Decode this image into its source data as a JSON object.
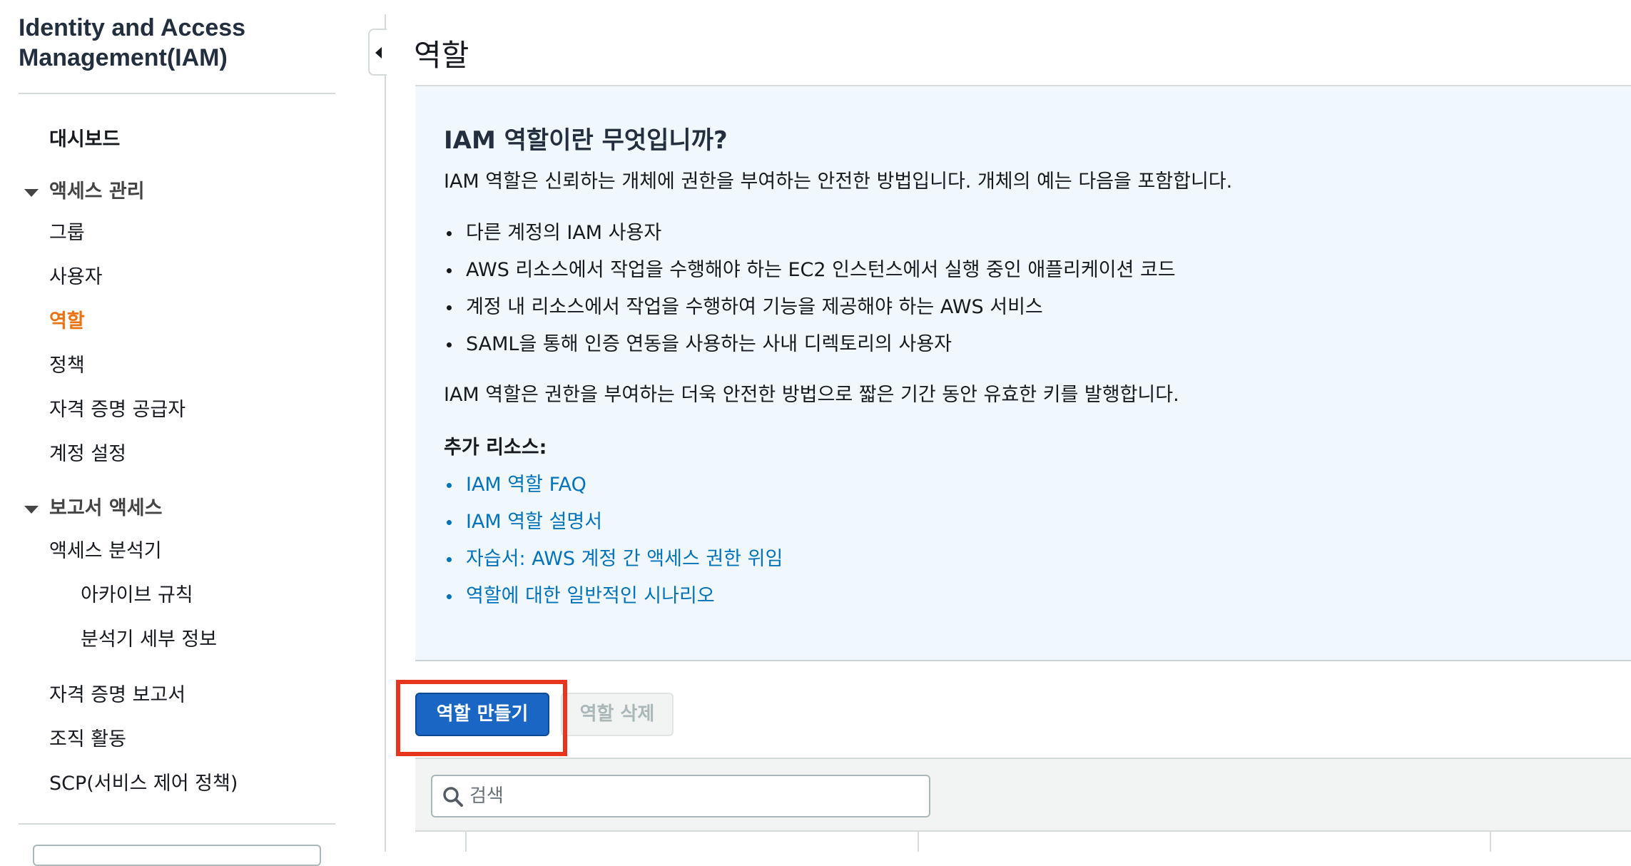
{
  "sidebar": {
    "title": "Identity and Access Management(IAM)",
    "dashboard": "대시보드",
    "access_management": {
      "label": "액세스 관리",
      "items": [
        "그룹",
        "사용자",
        "역할",
        "정책",
        "자격 증명 공급자",
        "계정 설정"
      ],
      "active_index": 2
    },
    "access_reports": {
      "label": "보고서 액세스",
      "analyzer": "액세스 분석기",
      "analyzer_items": [
        "아카이브 규칙",
        "분석기 세부 정보"
      ],
      "items": [
        "자격 증명 보고서",
        "조직 활동",
        "SCP(서비스 제어 정책)"
      ]
    }
  },
  "main": {
    "title": "역할",
    "info": {
      "heading": "IAM 역할이란 무엇입니까?",
      "intro": "IAM 역할은 신뢰하는 개체에 권한을 부여하는 안전한 방법입니다. 개체의 예는 다음을 포함합니다.",
      "examples": [
        "다른 계정의 IAM 사용자",
        "AWS 리소스에서 작업을 수행해야 하는 EC2 인스턴스에서 실행 중인 애플리케이션 코드",
        "계정 내 리소스에서 작업을 수행하여 기능을 제공해야 하는 AWS 서비스",
        "SAML을 통해 인증 연동을 사용하는 사내 디렉토리의 사용자"
      ],
      "summary": "IAM 역할은 권한을 부여하는 더욱 안전한 방법으로 짧은 기간 동안 유효한 키를 발행합니다.",
      "resources_label": "추가 리소스:",
      "resources": [
        "IAM 역할 FAQ",
        "IAM 역할 설명서",
        "자습서: AWS 계정 간 액세스 권한 위임",
        "역할에 대한 일반적인 시나리오"
      ]
    },
    "actions": {
      "create_label": "역할 만들기",
      "delete_label": "역할 삭제"
    },
    "search": {
      "placeholder": "검색",
      "value": ""
    }
  },
  "colors": {
    "active_nav": "#ec7211",
    "link": "#0073bb",
    "primary_button": "#1a66c4",
    "highlight": "#e8351d",
    "info_bg": "#f1f8fd"
  },
  "icons": {
    "collapse": "caret-left-icon",
    "section_toggle": "caret-down-icon",
    "search": "search-icon"
  }
}
